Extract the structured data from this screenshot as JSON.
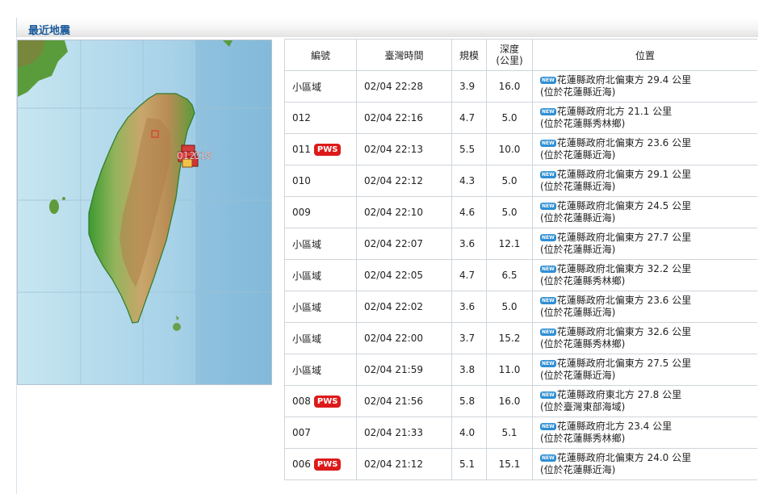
{
  "section": {
    "title": "最近地震"
  },
  "map": {
    "marker_labels": [
      "012",
      "018"
    ]
  },
  "table": {
    "headers": {
      "id": "編號",
      "time": "臺灣時間",
      "magnitude": "規模",
      "depth_line1": "深度",
      "depth_line2": "(公里)",
      "location": "位置"
    },
    "new_tag": "NEW",
    "pws_tag": "PWS",
    "rows": [
      {
        "id": "小區域",
        "pws": false,
        "time": "02/04 22:28",
        "mag": "3.9",
        "depth": "16.0",
        "loc1": "花蓮縣政府北偏東方 29.4 公里",
        "loc2": "(位於花蓮縣近海)"
      },
      {
        "id": "012",
        "pws": false,
        "time": "02/04 22:16",
        "mag": "4.7",
        "depth": "5.0",
        "loc1": "花蓮縣政府北方 21.1 公里",
        "loc2": "(位於花蓮縣秀林鄉)"
      },
      {
        "id": "011",
        "pws": true,
        "time": "02/04 22:13",
        "mag": "5.5",
        "depth": "10.0",
        "loc1": "花蓮縣政府北偏東方 23.6 公里",
        "loc2": "(位於花蓮縣近海)"
      },
      {
        "id": "010",
        "pws": false,
        "time": "02/04 22:12",
        "mag": "4.3",
        "depth": "5.0",
        "loc1": "花蓮縣政府北偏東方 29.1 公里",
        "loc2": "(位於花蓮縣近海)"
      },
      {
        "id": "009",
        "pws": false,
        "time": "02/04 22:10",
        "mag": "4.6",
        "depth": "5.0",
        "loc1": "花蓮縣政府北偏東方 24.5 公里",
        "loc2": "(位於花蓮縣近海)"
      },
      {
        "id": "小區域",
        "pws": false,
        "time": "02/04 22:07",
        "mag": "3.6",
        "depth": "12.1",
        "loc1": "花蓮縣政府北偏東方 27.7 公里",
        "loc2": "(位於花蓮縣近海)"
      },
      {
        "id": "小區域",
        "pws": false,
        "time": "02/04 22:05",
        "mag": "4.7",
        "depth": "6.5",
        "loc1": "花蓮縣政府北偏東方 32.2 公里",
        "loc2": "(位於花蓮縣秀林鄉)"
      },
      {
        "id": "小區域",
        "pws": false,
        "time": "02/04 22:02",
        "mag": "3.6",
        "depth": "5.0",
        "loc1": "花蓮縣政府北偏東方 23.6 公里",
        "loc2": "(位於花蓮縣近海)"
      },
      {
        "id": "小區域",
        "pws": false,
        "time": "02/04 22:00",
        "mag": "3.7",
        "depth": "15.2",
        "loc1": "花蓮縣政府北偏東方 32.6 公里",
        "loc2": "(位於花蓮縣秀林鄉)"
      },
      {
        "id": "小區域",
        "pws": false,
        "time": "02/04 21:59",
        "mag": "3.8",
        "depth": "11.0",
        "loc1": "花蓮縣政府北偏東方 27.5 公里",
        "loc2": "(位於花蓮縣近海)"
      },
      {
        "id": "008",
        "pws": true,
        "time": "02/04 21:56",
        "mag": "5.8",
        "depth": "16.0",
        "loc1": "花蓮縣政府東北方 27.8 公里",
        "loc2": "(位於臺灣東部海域)"
      },
      {
        "id": "007",
        "pws": false,
        "time": "02/04 21:33",
        "mag": "4.0",
        "depth": "5.1",
        "loc1": "花蓮縣政府北方 23.4 公里",
        "loc2": "(位於花蓮縣秀林鄉)"
      },
      {
        "id": "006",
        "pws": true,
        "time": "02/04 21:12",
        "mag": "5.1",
        "depth": "15.1",
        "loc1": "花蓮縣政府北偏東方 24.0 公里",
        "loc2": "(位於花蓮縣近海)"
      }
    ]
  }
}
